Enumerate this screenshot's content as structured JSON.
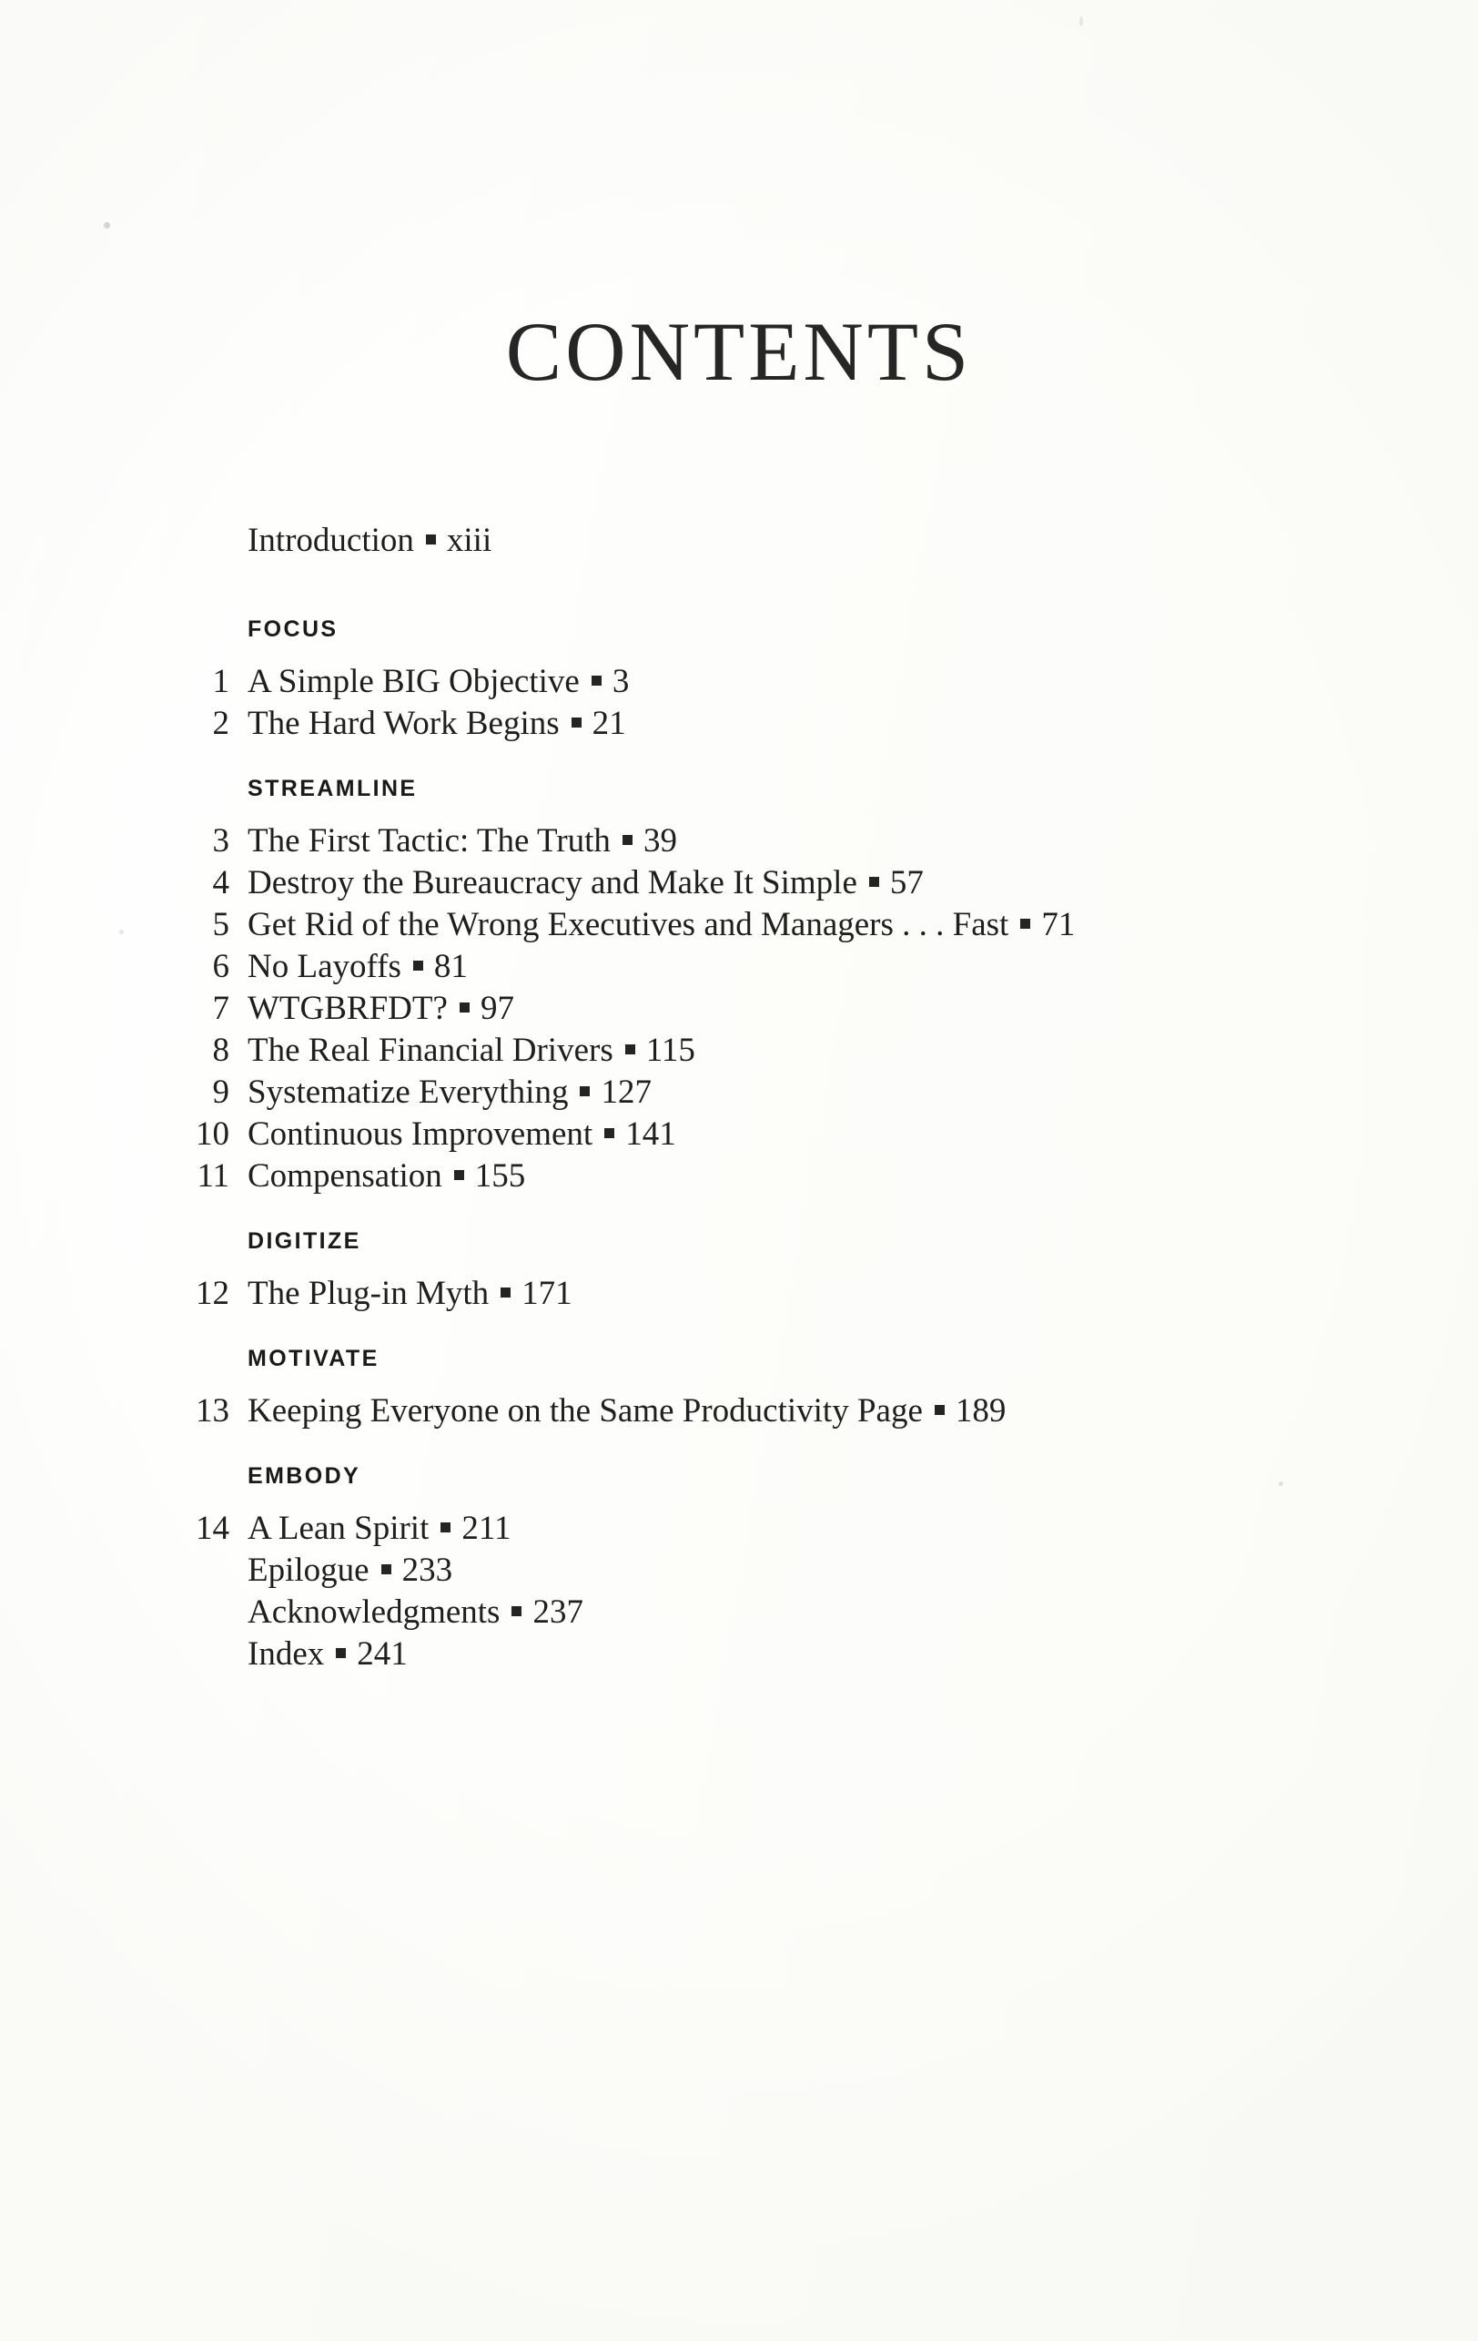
{
  "page": {
    "title": "CONTENTS",
    "separator_glyph": "square-bullet"
  },
  "front_matter": [
    {
      "label": "Introduction",
      "page": "xiii"
    }
  ],
  "parts": [
    {
      "name": "FOCUS",
      "entries": [
        {
          "number": "1",
          "title": "A Simple BIG Objective",
          "page": "3"
        },
        {
          "number": "2",
          "title": "The Hard Work Begins",
          "page": "21"
        }
      ]
    },
    {
      "name": "STREAMLINE",
      "entries": [
        {
          "number": "3",
          "title": "The First Tactic: The Truth",
          "page": "39"
        },
        {
          "number": "4",
          "title": "Destroy the Bureaucracy and Make It Simple",
          "page": "57"
        },
        {
          "number": "5",
          "title": "Get Rid of the Wrong Executives and Managers . . . Fast",
          "page": "71"
        },
        {
          "number": "6",
          "title": "No Layoffs",
          "page": "81"
        },
        {
          "number": "7",
          "title": "WTGBRFDT?",
          "page": "97"
        },
        {
          "number": "8",
          "title": "The Real Financial Drivers",
          "page": "115"
        },
        {
          "number": "9",
          "title": "Systematize Everything",
          "page": "127"
        },
        {
          "number": "10",
          "title": "Continuous Improvement",
          "page": "141"
        },
        {
          "number": "11",
          "title": "Compensation",
          "page": "155"
        }
      ]
    },
    {
      "name": "DIGITIZE",
      "entries": [
        {
          "number": "12",
          "title": "The Plug-in Myth",
          "page": "171"
        }
      ]
    },
    {
      "name": "MOTIVATE",
      "entries": [
        {
          "number": "13",
          "title": "Keeping Everyone on the Same Productivity Page",
          "page": "189"
        }
      ]
    },
    {
      "name": "EMBODY",
      "entries": [
        {
          "number": "14",
          "title": "A Lean Spirit",
          "page": "211"
        }
      ]
    }
  ],
  "back_matter": [
    {
      "label": "Epilogue",
      "page": "233"
    },
    {
      "label": "Acknowledgments",
      "page": "237"
    },
    {
      "label": "Index",
      "page": "241"
    }
  ]
}
